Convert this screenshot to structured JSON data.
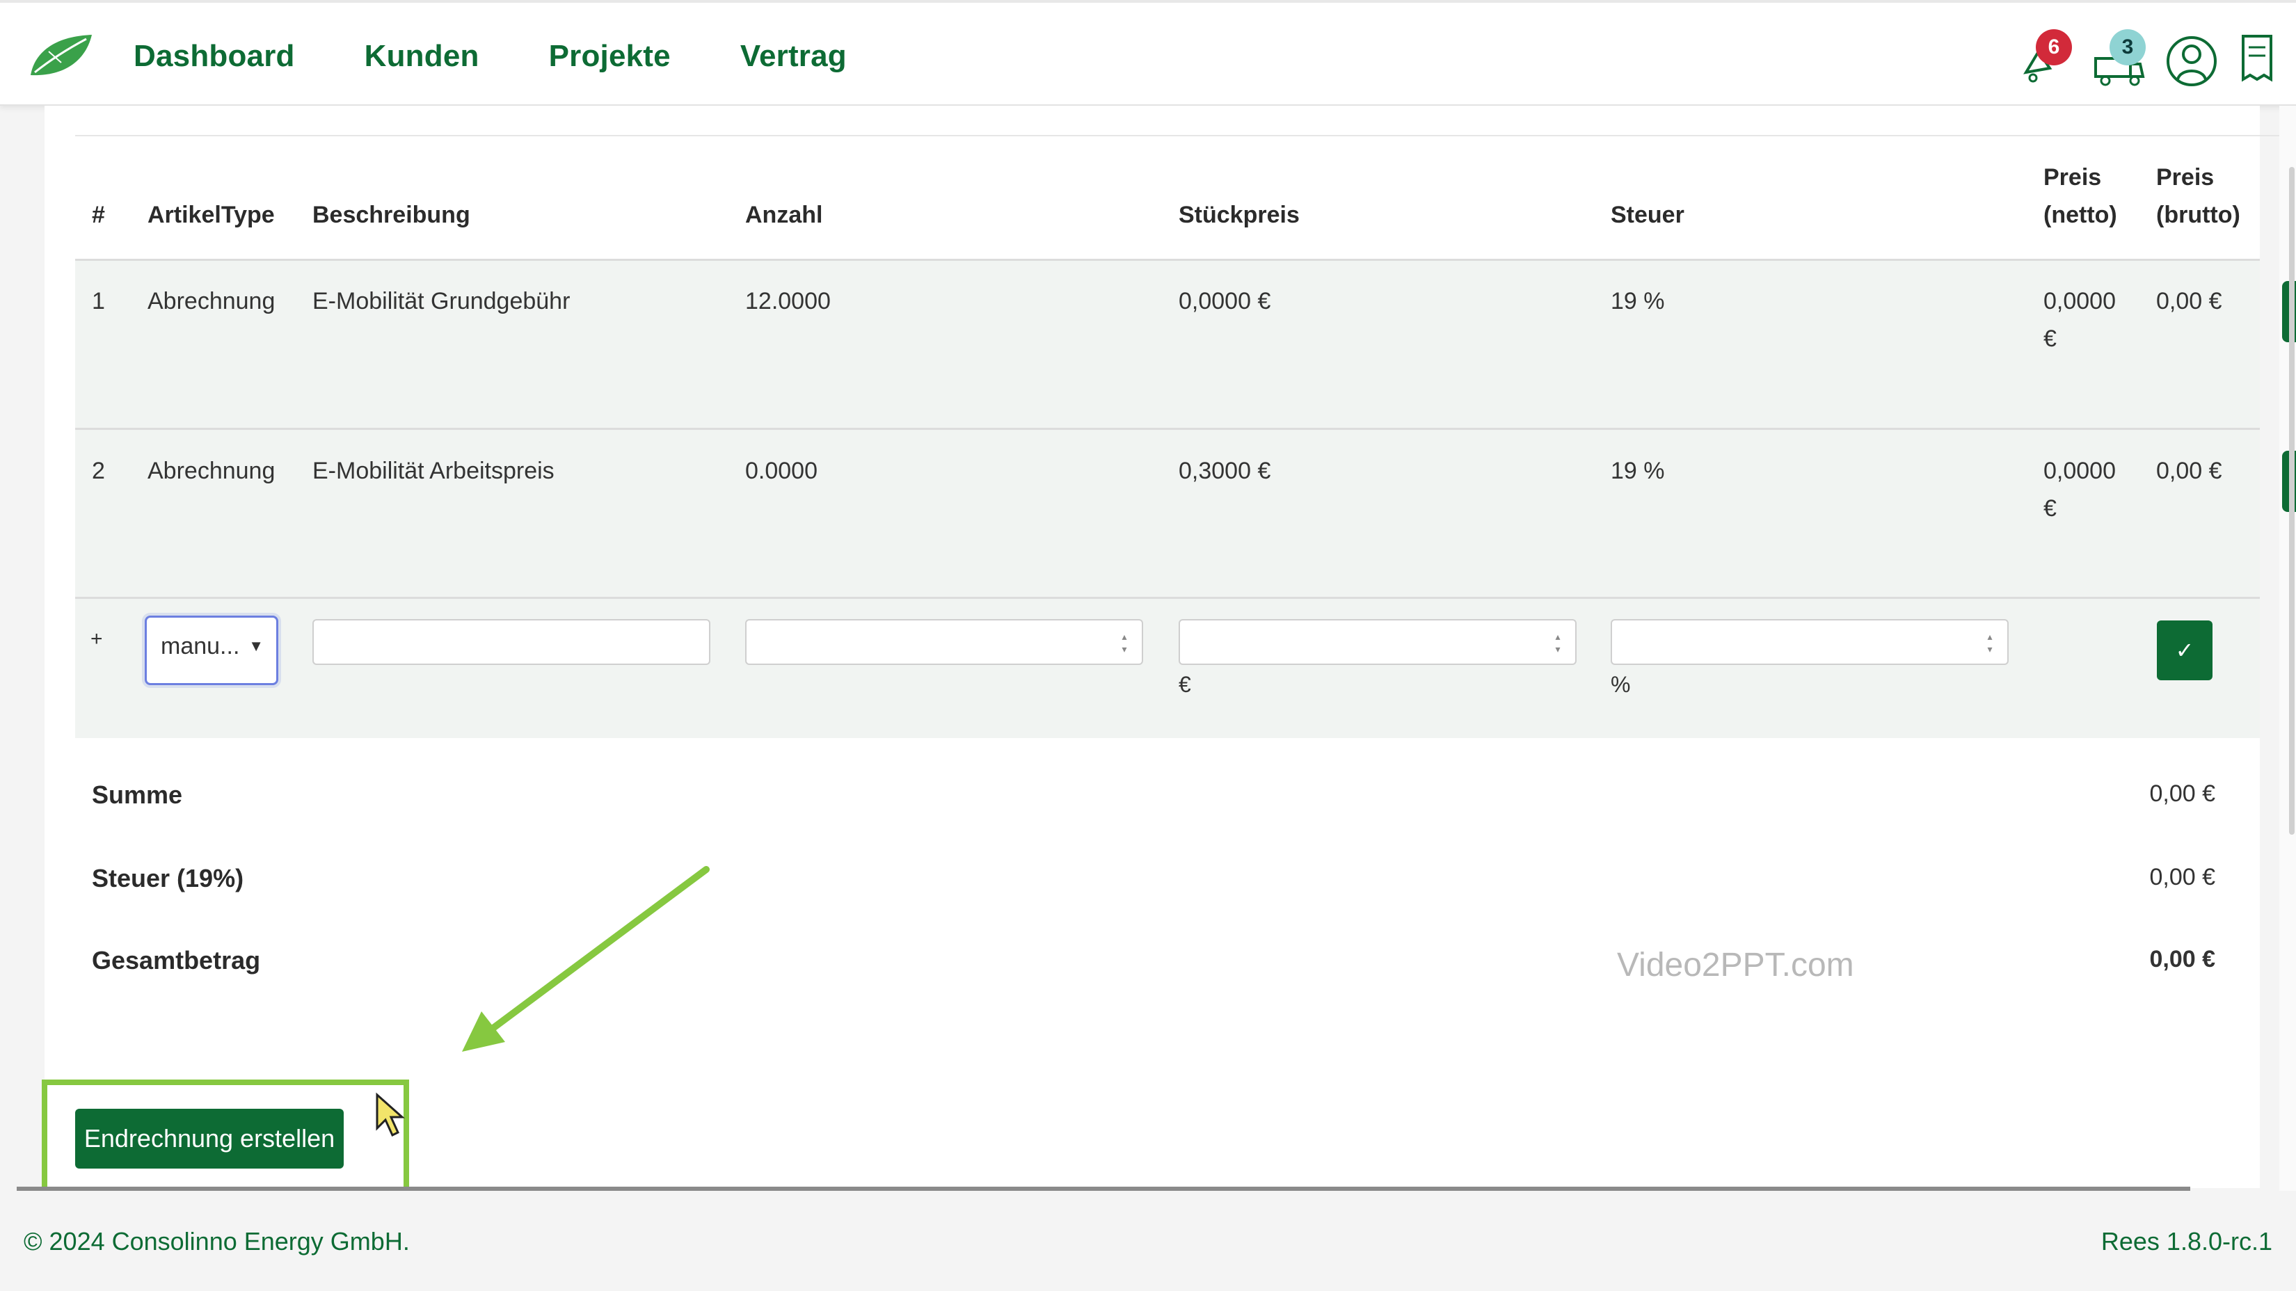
{
  "nav": [
    "Dashboard",
    "Kunden",
    "Projekte",
    "Vertrag"
  ],
  "badges": {
    "notifications": "6",
    "messages": "3"
  },
  "table": {
    "headers": {
      "num": "#",
      "type": "ArtikelType",
      "desc": "Beschreibung",
      "qty": "Anzahl",
      "unit_price": "Stückpreis",
      "tax": "Steuer",
      "net_1": "Preis",
      "net_2": "(netto)",
      "gross_1": "Preis",
      "gross_2": "(brutto)"
    },
    "rows": [
      {
        "num": "1",
        "type": "Abrechnung",
        "desc": "E-Mobilität Grundgebühr",
        "qty": "12.0000",
        "unit_price": "0,0000 €",
        "tax": "19 %",
        "net_1": "0,0000",
        "net_2": "€",
        "gross": "0,00 €"
      },
      {
        "num": "2",
        "type": "Abrechnung",
        "desc": "E-Mobilität Arbeitspreis",
        "qty": "0.0000",
        "unit_price": "0,3000 €",
        "tax": "19 %",
        "net_1": "0,0000",
        "net_2": "€",
        "gross": "0,00 €"
      }
    ],
    "new_row": {
      "plus": "+",
      "type_value": "manu...",
      "price_unit": "€",
      "tax_unit": "%"
    }
  },
  "summary": {
    "sum_label": "Summe",
    "sum_value": "0,00 €",
    "tax_label": "Steuer (19%)",
    "tax_value": "0,00 €",
    "total_label": "Gesamtbetrag",
    "total_value": "0,00 €"
  },
  "watermark": "Video2PPT.com",
  "action_button": "Endrechnung erstellen",
  "footer": {
    "copyright": "© 2024 Consolinno Energy GmbH.",
    "version": "Rees 1.8.0-rc.1"
  },
  "colors": {
    "brand": "#0d6b34",
    "highlight": "#86c840",
    "badge_red": "#d22a3a",
    "badge_teal": "#8fd3d3"
  }
}
